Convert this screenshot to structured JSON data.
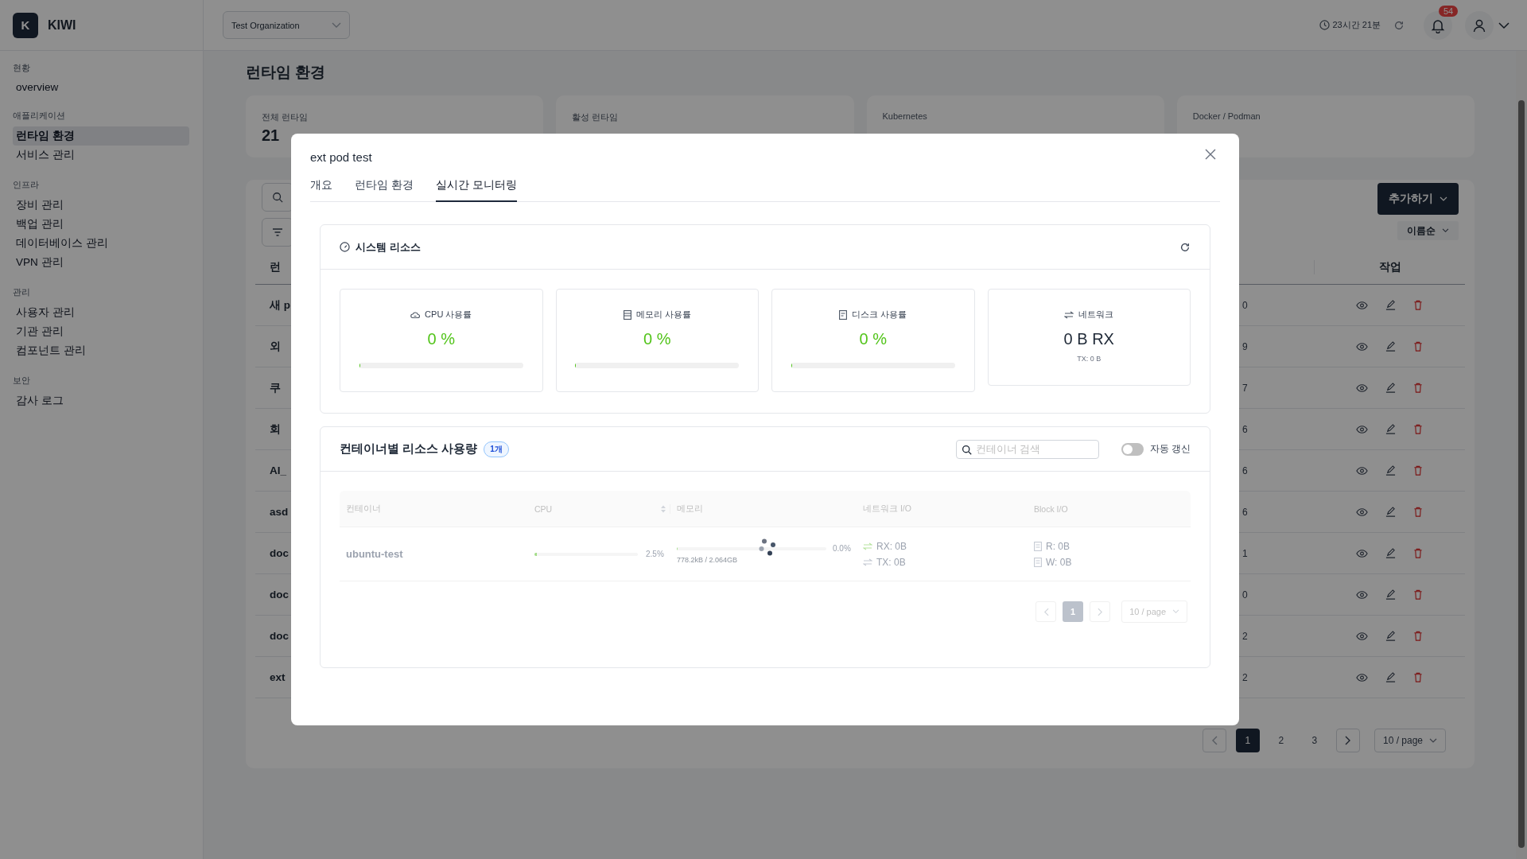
{
  "sidebar": {
    "logo": {
      "letter": "K",
      "name": "KIWI"
    },
    "sections": [
      {
        "heading": "현황",
        "items": [
          {
            "label": "overview",
            "selected": false
          }
        ]
      },
      {
        "heading": "애플리케이션",
        "items": [
          {
            "label": "런타임 환경",
            "selected": true
          },
          {
            "label": "서비스 관리",
            "selected": false
          }
        ]
      },
      {
        "heading": "인프라",
        "items": [
          {
            "label": "장비 관리",
            "selected": false
          },
          {
            "label": "백업 관리",
            "selected": false
          },
          {
            "label": "데이터베이스 관리",
            "selected": false
          },
          {
            "label": "VPN 관리",
            "selected": false
          }
        ]
      },
      {
        "heading": "관리",
        "items": [
          {
            "label": "사용자 관리",
            "selected": false
          },
          {
            "label": "기관 관리",
            "selected": false
          },
          {
            "label": "컴포넌트 관리",
            "selected": false
          }
        ]
      },
      {
        "heading": "보안",
        "items": [
          {
            "label": "감사 로그",
            "selected": false
          }
        ]
      }
    ]
  },
  "header": {
    "organization": "Test Organization",
    "session_time": "23시간 21분",
    "notification_count": "54"
  },
  "page": {
    "title": "런타임 환경",
    "stats": [
      {
        "label": "전체 런타임",
        "value": "21"
      },
      {
        "label": "활성 런타임"
      },
      {
        "label": "Kubernetes"
      },
      {
        "label": "Docker / Podman"
      }
    ],
    "add_button": "추가하기",
    "sort": "이름순",
    "table": {
      "columns": [
        "런",
        "작업"
      ],
      "rows": [
        {
          "column_1": "새 p",
          "column_2": "0"
        },
        {
          "column_1": "외",
          "column_2": "9"
        },
        {
          "column_1": "쿠",
          "column_2": "7"
        },
        {
          "column_1": "회",
          "column_2": "6"
        },
        {
          "column_1": "AI_",
          "column_2": "6"
        },
        {
          "column_1": "asd",
          "column_2": "6"
        },
        {
          "column_1": "doc",
          "column_2": "1"
        },
        {
          "column_1": "doc",
          "column_2": "0"
        },
        {
          "column_1": "doc",
          "column_2": "2"
        },
        {
          "column_1": "ext",
          "column_2": "2"
        }
      ]
    },
    "pagination": {
      "pages": [
        {
          "label": "1",
          "selected": true
        },
        {
          "label": "2",
          "selected": false
        },
        {
          "label": "3",
          "selected": false
        }
      ],
      "page_size": "10 / page"
    }
  },
  "modal": {
    "title": "ext pod test",
    "tabs": [
      {
        "label": "개요",
        "selected": false
      },
      {
        "label": "런타임 환경",
        "selected": false
      },
      {
        "label": "실시간 모니터링",
        "selected": true
      }
    ],
    "system_resources": {
      "title": "시스템 리소스",
      "metrics": [
        {
          "kind": "cpu",
          "label": "CPU 사용률",
          "value": "0 %",
          "level": 0
        },
        {
          "kind": "memory",
          "label": "메모리 사용률",
          "value": "0 %",
          "level": 0
        },
        {
          "kind": "disk",
          "label": "디스크 사용률",
          "value": "0 %",
          "level": 0
        },
        {
          "kind": "network",
          "label": "네트워크",
          "value": "0 B RX",
          "sub": "TX: 0 B"
        }
      ]
    },
    "containers": {
      "title": "컨테이너별 리소스 사용량",
      "count": "1개",
      "search": {
        "placeholder": "컨테이너 검색"
      },
      "auto_refresh": {
        "label": "자동 갱신",
        "on": false
      },
      "loading": true,
      "columns": [
        "컨테이너",
        "CPU",
        "메모리",
        "네트워크 I/O",
        "Block I/O"
      ],
      "rows": [
        {
          "name": "ubuntu-test",
          "cpu": {
            "level": 0.025,
            "reading": "2.5%"
          },
          "memory": {
            "level": 0,
            "reading": "0.0%",
            "usage": "778.2kB / 2.064GB"
          },
          "network": {
            "rx": "RX: 0B",
            "tx": "TX: 0B"
          },
          "block_io": {
            "read": "R: 0B",
            "write": "W: 0B"
          }
        }
      ],
      "pagination": {
        "pages": [
          {
            "label": "1",
            "selected": true
          }
        ],
        "page_size": "10 / page"
      }
    }
  }
}
